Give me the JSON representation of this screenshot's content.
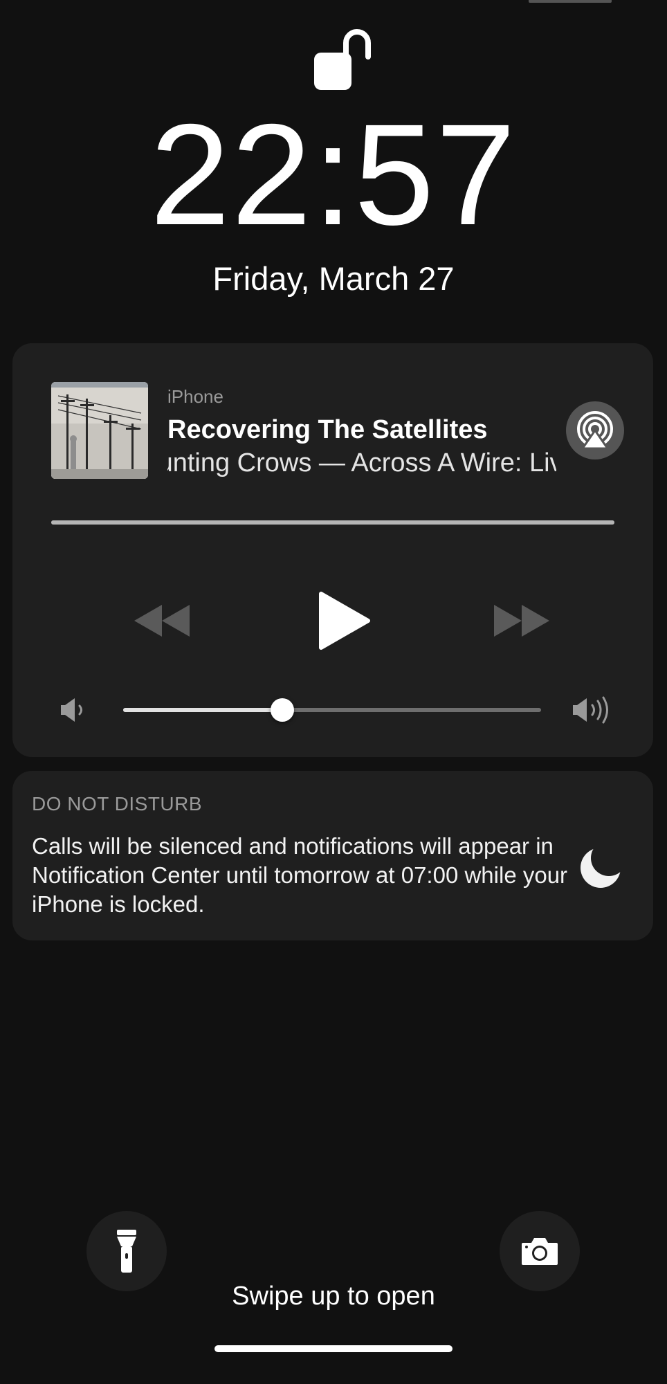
{
  "lock_screen": {
    "time": "22:57",
    "date": "Friday, March 27",
    "lock_state": "unlocked"
  },
  "now_playing": {
    "source": "iPhone",
    "title": "Recovering The Satellites",
    "artist_album": "Counting Crows — Across A Wire: Live In New York",
    "progress_fraction": 1.0,
    "volume_fraction": 0.38,
    "state": "paused"
  },
  "do_not_disturb": {
    "heading": "DO NOT DISTURB",
    "body": "Calls will be silenced and notifications will appear in Notification Center until tomorrow at 07:00 while your iPhone is locked."
  },
  "bottom": {
    "swipe_hint": "Swipe up to open"
  },
  "icons": {
    "lock": "unlocked-padlock-icon",
    "airplay": "airplay-icon",
    "rewind": "rewind-icon",
    "play": "play-icon",
    "forward": "fast-forward-icon",
    "volume_low": "speaker-low-icon",
    "volume_high": "speaker-high-icon",
    "moon": "moon-icon",
    "flashlight": "flashlight-icon",
    "camera": "camera-icon"
  },
  "colors": {
    "background": "#111111",
    "card": "#1f1f1f",
    "text_primary": "#ffffff",
    "text_secondary": "#9a9a9a"
  }
}
